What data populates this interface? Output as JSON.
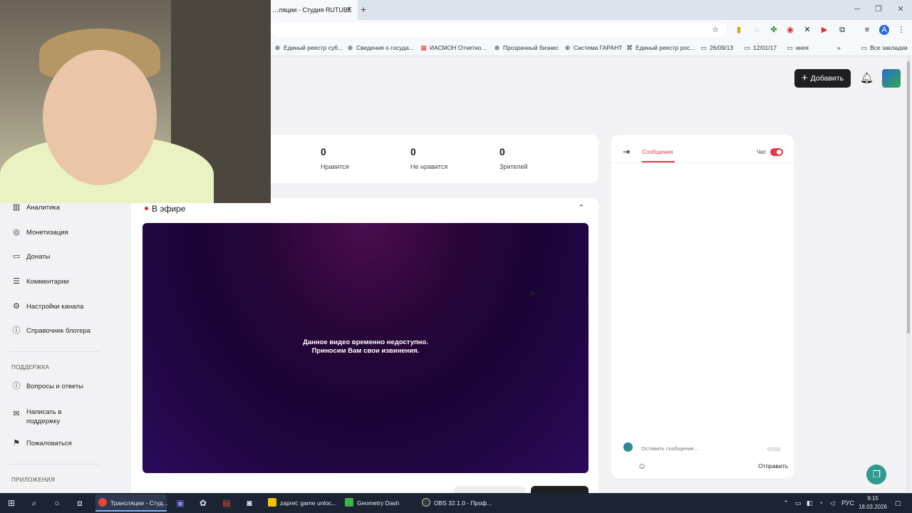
{
  "browser": {
    "tab_title": "…ляции - Студия RUTUBE",
    "tab_close": "×",
    "new_tab": "+",
    "window_minimize": "─",
    "window_restore": "❐",
    "window_close": "✕",
    "bookmarks": [
      {
        "label": "Единый реестр суб...",
        "icon": "globe-icon"
      },
      {
        "label": "Сведения о госуда...",
        "icon": "globe-icon"
      },
      {
        "label": "ИАСМОН Отчетно...",
        "icon": "grid-icon"
      },
      {
        "label": "Прозрачный бизнес",
        "icon": "globe-icon"
      },
      {
        "label": "Система ГАРАНТ",
        "icon": "globe-icon"
      },
      {
        "label": "Единый реестр рос...",
        "icon": "network-icon"
      },
      {
        "label": "26/09/13",
        "icon": "folder-icon"
      },
      {
        "label": "12/01/17",
        "icon": "folder-icon"
      },
      {
        "label": "икея",
        "icon": "folder-icon"
      },
      {
        "label": "Все закладки",
        "icon": "folder-icon"
      }
    ]
  },
  "header": {
    "add_button": "Добавить",
    "plus": "+"
  },
  "stats": [
    {
      "value": "0",
      "label": "Нравится"
    },
    {
      "value": "0",
      "label": "Не нравится"
    },
    {
      "value": "0",
      "label": "Зрителей"
    }
  ],
  "sidebar": {
    "items": [
      {
        "label": "Аналитика",
        "icon": "analytics-icon"
      },
      {
        "label": "Монетизация",
        "icon": "coin-icon"
      },
      {
        "label": "Донаты",
        "icon": "donate-icon"
      },
      {
        "label": "Комментарии",
        "icon": "comment-icon"
      },
      {
        "label": "Настройки канала",
        "icon": "gear-icon"
      },
      {
        "label": "Справочник блогера",
        "icon": "info-icon"
      }
    ],
    "support_title": "ПОДДЕРЖКА",
    "support_items": [
      {
        "label": "Вопросы и ответы",
        "icon": "question-icon"
      },
      {
        "label": "Написать в\nподдержку",
        "icon": "mail-icon"
      },
      {
        "label": "Пожаловаться",
        "icon": "flag-icon"
      }
    ],
    "apps_title": "ПРИЛОЖЕНИЯ"
  },
  "live": {
    "title": "В эфире",
    "collapse_icon": "⌃",
    "message_line1": "Данное видео временно недоступно.",
    "message_line2": "Приносим Вам свои извинения."
  },
  "chat": {
    "tab_label": "Сообщения",
    "toggle_label": "Чат",
    "toggle_on": true,
    "input_placeholder": "Оставить сообщение...",
    "counter": "0/200",
    "send_label": "Отправить"
  },
  "taskbar": {
    "apps": [
      {
        "label": "Трансляции - Студ...",
        "active": true,
        "color": "#e8453c"
      },
      {
        "label": "zapret: game unloc...",
        "active": false,
        "color": "#f2c200"
      },
      {
        "label": "Geometry Dash",
        "active": false,
        "color": "#39b54a"
      },
      {
        "label": "OBS 32.1.0 - Проф...",
        "active": false,
        "color": "#3a3a3a"
      }
    ],
    "lang": "РУС",
    "time": "9:15",
    "date": "18.03.2026"
  }
}
